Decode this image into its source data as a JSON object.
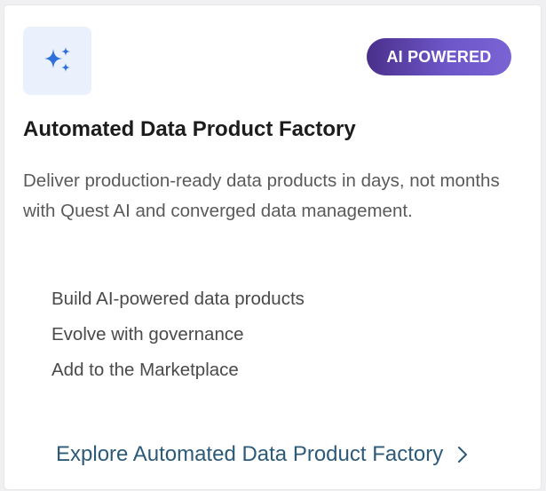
{
  "card": {
    "icon": "sparkles-icon",
    "badge": "AI POWERED",
    "title": "Automated Data Product Factory",
    "description": "Deliver production-ready data products in days, not months with Quest AI and converged data management.",
    "features": [
      "Build AI-powered data products",
      "Evolve with governance",
      "Add to the Marketplace"
    ],
    "link": {
      "label": "Explore Automated Data Product Factory",
      "icon": "chevron-right-icon"
    }
  },
  "colors": {
    "icon_bg": "#eaf1fc",
    "icon_fill": "#2f6fdc",
    "badge_start": "#4a2f8a",
    "badge_end": "#7a64d4",
    "link": "#2c5a78",
    "title": "#1c1c1c",
    "body_text": "#5a5a5a"
  }
}
